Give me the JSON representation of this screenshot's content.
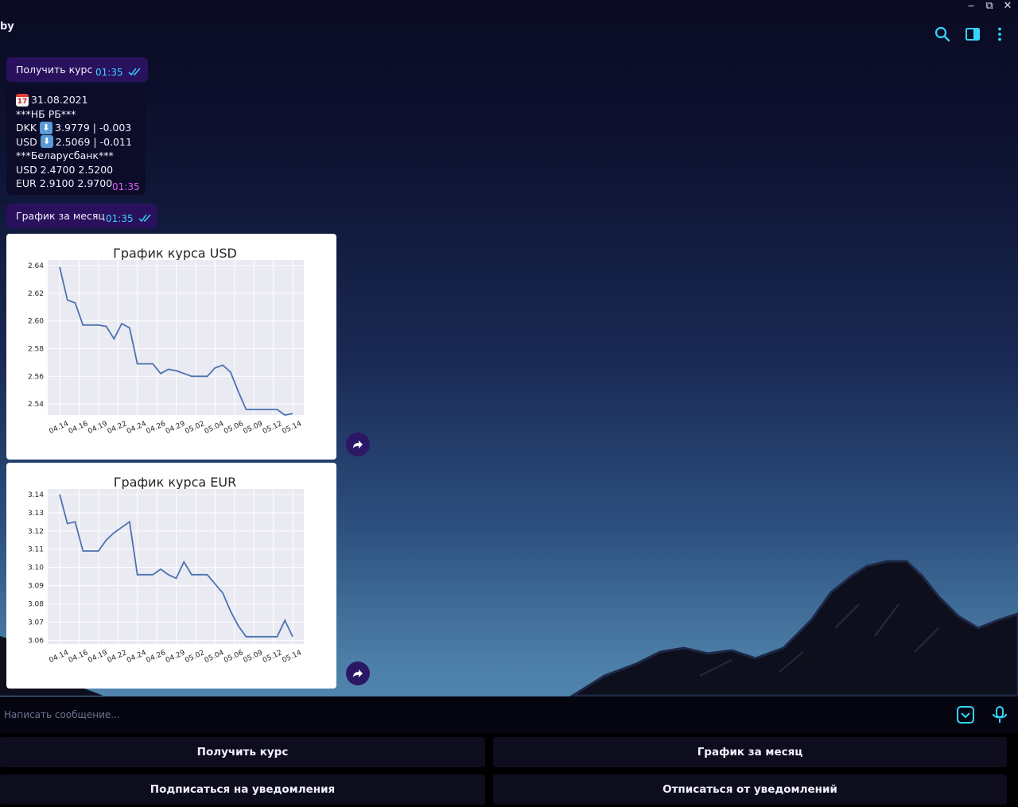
{
  "window": {
    "title": "by",
    "controls": {
      "minimize": "‒",
      "restore": "⧉",
      "close": "✕"
    },
    "toolbar_icons": [
      "search-icon",
      "sidebar-toggle-icon",
      "more-vertical-icon"
    ]
  },
  "messages": [
    {
      "type": "outgoing",
      "text": "Получить курс",
      "time": "01:35"
    },
    {
      "type": "incoming",
      "time": "01:35",
      "lines": [
        {
          "emoji": "calendar-icon",
          "text": "31.08.2021"
        },
        {
          "emoji": "",
          "text": "***НБ РБ***"
        },
        {
          "prefix": "DKK",
          "emoji": "down-arrow-icon",
          "text": "3.9779 | -0.003"
        },
        {
          "prefix": "USD",
          "emoji": "down-arrow-icon",
          "text": "2.5069 | -0.011"
        },
        {
          "emoji": "",
          "text": "***Беларусбанк***"
        },
        {
          "emoji": "",
          "text": "USD 2.4700 2.5200"
        },
        {
          "emoji": "",
          "text": "EUR 2.9100 2.9700"
        }
      ]
    },
    {
      "type": "outgoing",
      "text": "График за месяц",
      "time": "01:35"
    }
  ],
  "chart_data": [
    {
      "type": "line",
      "title": "График курса USD",
      "xlabel": "",
      "ylabel": "",
      "x_ticks": [
        "04.14",
        "04.16",
        "04.19",
        "04.22",
        "04.24",
        "04.26",
        "04.29",
        "05.02",
        "05.04",
        "05.06",
        "05.09",
        "05.12",
        "05.14"
      ],
      "ylim": [
        2.532,
        2.644
      ],
      "y_ticks": [
        2.54,
        2.56,
        2.58,
        2.6,
        2.62,
        2.64
      ],
      "grid": true,
      "values": [
        2.639,
        2.615,
        2.613,
        2.597,
        2.597,
        2.597,
        2.596,
        2.587,
        2.598,
        2.595,
        2.569,
        2.569,
        2.569,
        2.562,
        2.565,
        2.564,
        2.562,
        2.56,
        2.56,
        2.56,
        2.566,
        2.568,
        2.563,
        2.549,
        2.536,
        2.536,
        2.536,
        2.536,
        2.536,
        2.532,
        2.533
      ]
    },
    {
      "type": "line",
      "title": "График курса EUR",
      "xlabel": "",
      "ylabel": "",
      "x_ticks": [
        "04.14",
        "04.16",
        "04.19",
        "04.22",
        "04.24",
        "04.26",
        "04.29",
        "05.02",
        "05.04",
        "05.06",
        "05.09",
        "05.12",
        "05.14"
      ],
      "ylim": [
        3.058,
        3.143
      ],
      "y_ticks": [
        3.06,
        3.07,
        3.08,
        3.09,
        3.1,
        3.11,
        3.12,
        3.13,
        3.14
      ],
      "grid": true,
      "values": [
        3.14,
        3.124,
        3.125,
        3.109,
        3.109,
        3.109,
        3.115,
        3.119,
        3.122,
        3.125,
        3.096,
        3.096,
        3.096,
        3.099,
        3.096,
        3.094,
        3.103,
        3.096,
        3.096,
        3.096,
        3.091,
        3.086,
        3.076,
        3.068,
        3.062,
        3.062,
        3.062,
        3.062,
        3.062,
        3.071,
        3.062
      ]
    }
  ],
  "input": {
    "placeholder": "Написать сообщение..."
  },
  "keyboard": {
    "row1": [
      "Получить курс",
      "График за месяц"
    ],
    "row2": [
      "Подписаться на уведомления",
      "Отписаться от уведомлений"
    ]
  },
  "colors": {
    "outgoing_bubble": "#2a115e",
    "incoming_bubble": "#0c0c28",
    "time_outgoing": "#35d4ff",
    "time_incoming": "#e25dff",
    "icon_accent": "#35d4ff",
    "chart_line": "#4c72b0",
    "chart_bg": "#eaeaf2"
  }
}
